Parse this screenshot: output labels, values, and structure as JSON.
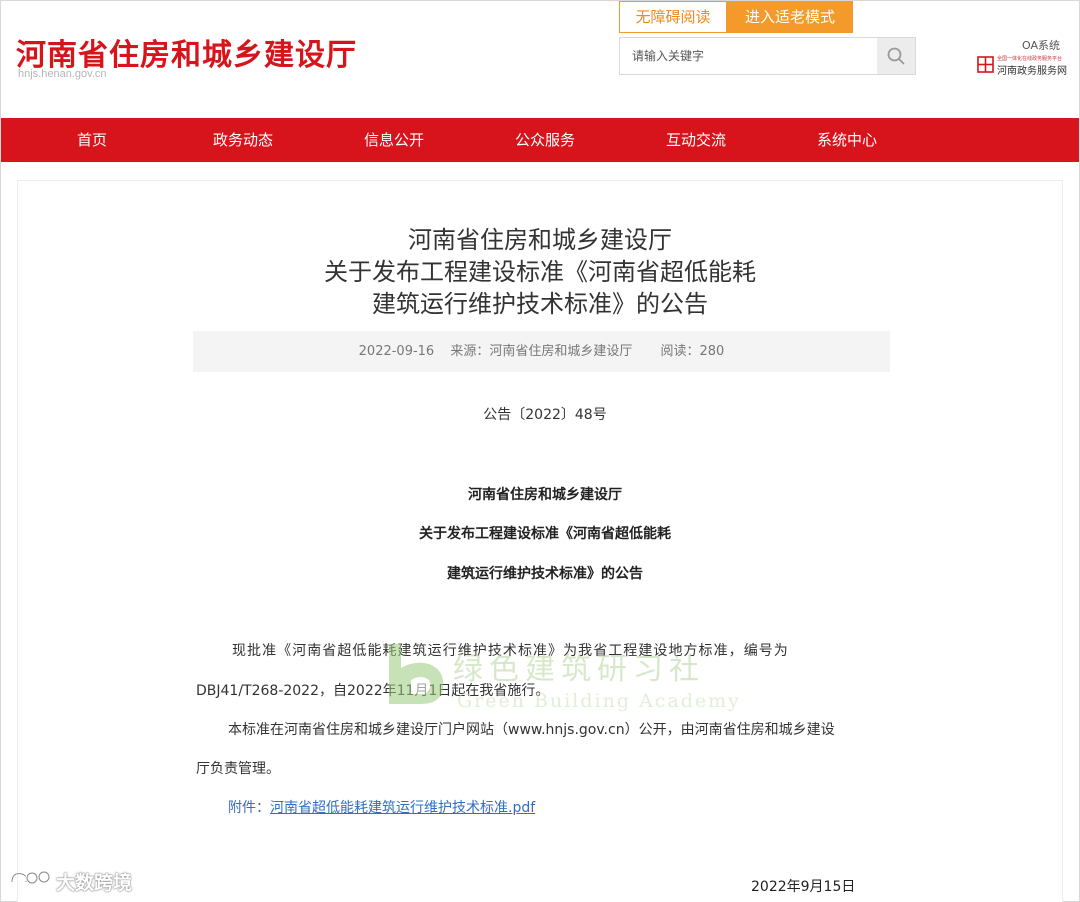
{
  "header": {
    "site_title": "河南省住房和城乡建设厅",
    "site_domain": "hnjs.henan.gov.cn",
    "accessibility_label": "无障碍阅读",
    "elder_mode_label": "进入适老模式",
    "search_placeholder": "请输入关键字",
    "oa_label": "OA系统",
    "gov_service_sub": "全国一体化在线政务服务平台",
    "gov_service_label": "河南政务服务网"
  },
  "nav": {
    "items": [
      {
        "label": "首页"
      },
      {
        "label": "政务动态"
      },
      {
        "label": "信息公开"
      },
      {
        "label": "公众服务"
      },
      {
        "label": "互动交流"
      },
      {
        "label": "系统中心"
      }
    ]
  },
  "article": {
    "title_lines": [
      "河南省住房和城乡建设厅",
      "关于发布工程建设标准《河南省超低能耗",
      "建筑运行维护技术标准》的公告"
    ],
    "meta": {
      "date": "2022-09-16",
      "source": "来源：河南省住房和城乡建设厅",
      "views": "阅读：280"
    },
    "doc_number": "公告〔2022〕48号",
    "bold_lines": [
      "河南省住房和城乡建设厅",
      "关于发布工程建设标准《河南省超低能耗",
      "建筑运行维护技术标准》的公告"
    ],
    "paragraphs": [
      "现批准《河南省超低能耗建筑运行维护技术标准》为我省工程建设地方标准，编号为",
      "DBJ41/T268-2022，自2022年11月1日起在我省施行。",
      "本标准在河南省住房和城乡建设厅门户网站（www.hnjs.gov.cn）公开，由河南省住房和城乡建设",
      "厅负责管理。"
    ],
    "attachment_prefix": "附件：",
    "attachment_link": "河南省超低能耗建筑运行维护技术标准.pdf",
    "sign_date": "2022年9月15日"
  },
  "watermarks": {
    "green_cn": "绿色建筑研习社",
    "green_en": "Green Building Academy",
    "bottom_left": "大数跨境"
  },
  "colors": {
    "brand_red": "#d7141b",
    "orange": "#f39a2b",
    "link_blue": "#2f6fc4"
  }
}
